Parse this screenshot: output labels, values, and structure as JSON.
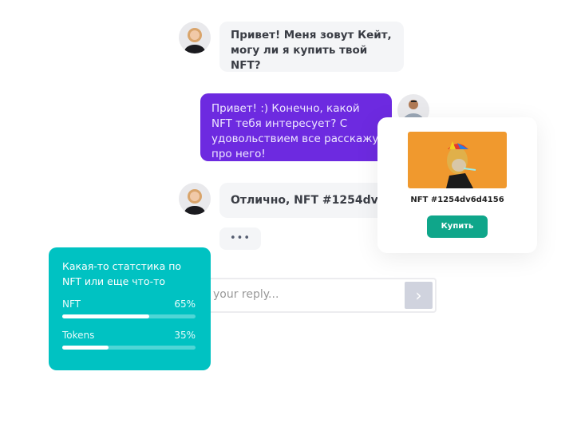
{
  "chat": {
    "messages": [
      {
        "sender": "Kate",
        "text": "Привет! Меня зовут Кейт, могу ли я купить твой NFT?"
      },
      {
        "sender": "me",
        "text": "Привет! :) Конечно, какой NFT тебя интересует? С удовольствием все расскажу про него!"
      },
      {
        "sender": "Kate",
        "text": "Отлично, NFT #1254dv6d4156"
      }
    ],
    "typing_indicator": "•••",
    "reply_placeholder": "your reply...",
    "send_icon": "chevron-right-icon"
  },
  "nft_card": {
    "name": "NFT #1254dv6d4156",
    "buy_label": "Купить",
    "image_bg": "#f0992e",
    "button_color": "#0fa68a"
  },
  "stats": {
    "title_line1": "Какая-то статстика по",
    "title_line2": "NFT или еще что-то",
    "items": [
      {
        "label": "NFT",
        "value_text": "65%",
        "value": 65
      },
      {
        "label": "Tokens",
        "value_text": "35%",
        "value": 35
      }
    ],
    "bg": "#00c2c2"
  },
  "colors": {
    "outgoing": "#6d2ae0",
    "incoming": "#f4f5f7"
  }
}
